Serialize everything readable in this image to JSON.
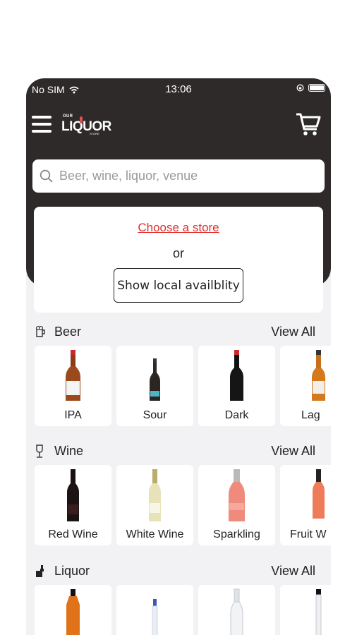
{
  "status_bar": {
    "carrier": "No SIM",
    "time": "13:06"
  },
  "header": {
    "logo": {
      "top_text": "OUR",
      "main_text": "LIQUOR",
      "bottom_text": "STORE"
    },
    "search_placeholder": "Beer, wine, liquor, venue"
  },
  "store": {
    "choose_label": "Choose a store",
    "or_label": "or",
    "show_local_label": "Show local availblity"
  },
  "colors": {
    "header_bg": "#2d2a29",
    "link_red": "#e03030",
    "page_bg": "#f2f2f4"
  },
  "sections": [
    {
      "title": "Beer",
      "icon": "beer-glass-icon",
      "view_all": "View All",
      "items": [
        {
          "label": "IPA",
          "bottle": "brown-beer-bottle"
        },
        {
          "label": "Sour",
          "bottle": "small-dark-beer-bottle"
        },
        {
          "label": "Dark",
          "bottle": "black-beer-bottle"
        },
        {
          "label": "Lag",
          "bottle": "amber-beer-bottle"
        }
      ]
    },
    {
      "title": "Wine",
      "icon": "wine-glass-icon",
      "view_all": "View All",
      "items": [
        {
          "label": "Red Wine",
          "bottle": "red-wine-bottle"
        },
        {
          "label": "White Wine",
          "bottle": "white-wine-bottle"
        },
        {
          "label": "Sparkling",
          "bottle": "sparkling-wine-bottle"
        },
        {
          "label": "Fruit W",
          "bottle": "fruit-wine-bottle"
        }
      ]
    },
    {
      "title": "Liquor",
      "icon": "liquor-icon",
      "view_all": "View All",
      "items": [
        {
          "label": "",
          "bottle": "whiskey-bottle"
        },
        {
          "label": "",
          "bottle": "vodka-bottle"
        },
        {
          "label": "",
          "bottle": "clear-spirit-bottle"
        },
        {
          "label": "",
          "bottle": "gin-bottle"
        }
      ]
    }
  ]
}
